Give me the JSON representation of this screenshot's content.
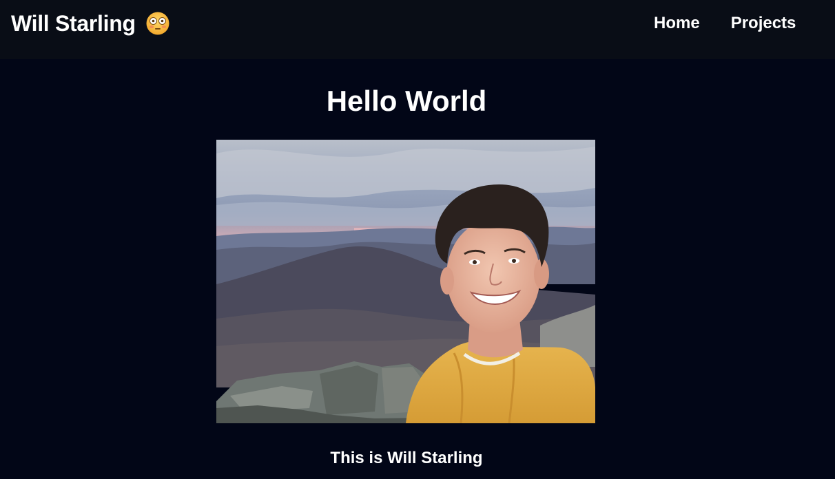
{
  "navbar": {
    "brand": "Will Starling",
    "brand_icon": "flushed-face-emoji-icon",
    "links": [
      "Home",
      "Projects"
    ]
  },
  "main": {
    "heading": "Hello World",
    "photo_icon": "profile-photo",
    "caption": "This is Will Starling"
  },
  "colors": {
    "page_background": "#020617",
    "navbar_background": "#090d16",
    "text": "#ffffff"
  }
}
